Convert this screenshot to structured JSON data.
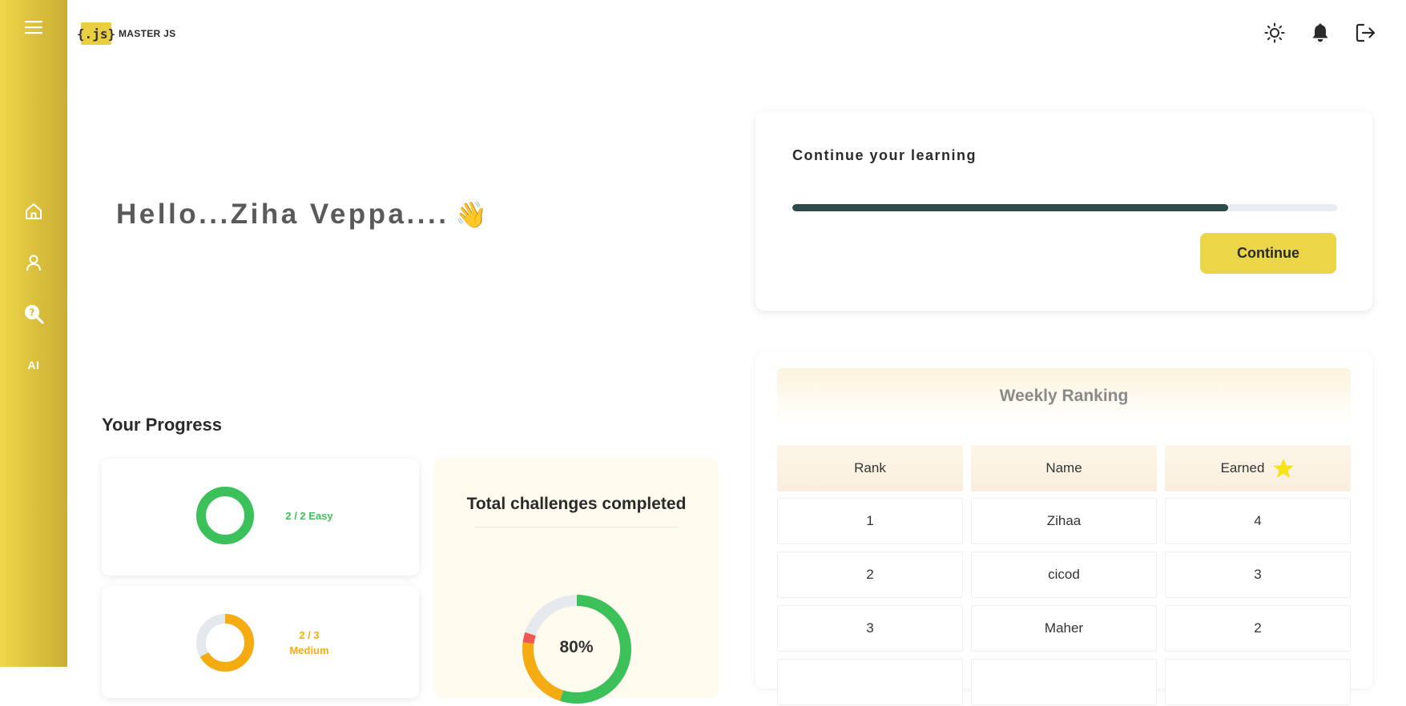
{
  "app": {
    "logo_mark": "{.js}",
    "name": "MASTER JS"
  },
  "sidebar": {
    "items": [
      {
        "name": "menu",
        "icon": "hamburger-icon"
      },
      {
        "name": "home",
        "icon": "home-icon"
      },
      {
        "name": "profile",
        "icon": "user-icon"
      },
      {
        "name": "quiz",
        "icon": "question-search-icon"
      },
      {
        "name": "ai",
        "label": "AI"
      }
    ]
  },
  "topbar": {
    "icons": [
      "sun-icon",
      "bell-icon",
      "logout-icon"
    ]
  },
  "greeting": {
    "text": "Hello...Ziha Veppa....",
    "emoji": "👋"
  },
  "continue_card": {
    "title": "Continue your learning",
    "progress_percent": 80,
    "button_label": "Continue"
  },
  "ranking": {
    "title": "Weekly Ranking",
    "columns": [
      "Rank",
      "Name",
      "Earned"
    ],
    "earned_icon": "star-icon",
    "rows": [
      {
        "rank": "1",
        "name": "Zihaa",
        "earned": "4"
      },
      {
        "rank": "2",
        "name": "cicod",
        "earned": "3"
      },
      {
        "rank": "3",
        "name": "Maher",
        "earned": "2"
      }
    ]
  },
  "progress": {
    "title": "Your Progress",
    "easy": {
      "label": "2 / 2 Easy",
      "done": 2,
      "total": 2,
      "color": "#3cc15a"
    },
    "medium": {
      "label_line1": "2 / 3",
      "label_line2": "Medium",
      "done": 2,
      "total": 3,
      "color": "#f5ab12"
    },
    "total": {
      "title": "Total challenges completed",
      "percent_label": "80%",
      "percent": 80
    }
  },
  "colors": {
    "accent_yellow": "#ebd648",
    "progress_dark": "#2f4a4a",
    "green": "#3cc15a",
    "orange": "#f5ab12",
    "red": "#f0574f"
  }
}
